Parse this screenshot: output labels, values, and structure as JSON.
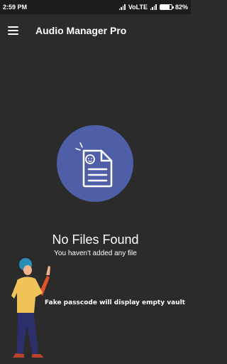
{
  "status_bar": {
    "time": "2:59 PM",
    "network": "VoLTE",
    "battery": "82%",
    "battery_level": 0.82
  },
  "app_bar": {
    "title": "Audio Manager Pro",
    "menu_icon": "hamburger-menu-icon"
  },
  "empty_state": {
    "icon": "empty-document-icon",
    "title": "No Files Found",
    "subtitle": "You haven't added any file"
  },
  "overlay": {
    "caption": "Fake passcode will display empty vault",
    "illustration": "pointing-person-illustration"
  },
  "colors": {
    "background": "#2b2b2b",
    "status_bar": "#1c1c1c",
    "accent_circle": "#4f5fa7"
  }
}
